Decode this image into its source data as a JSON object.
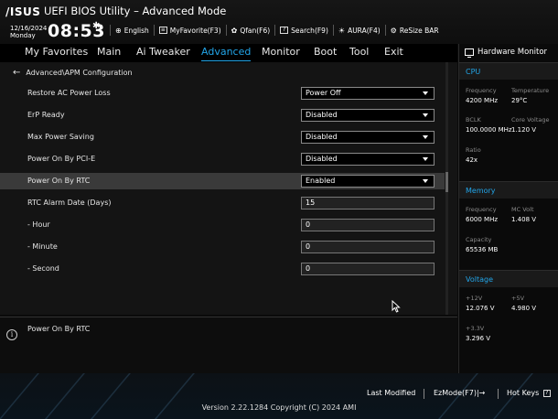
{
  "header": {
    "logo": "/ISUS",
    "title": "UEFI BIOS Utility – Advanced Mode",
    "date": "12/16/2024",
    "day": "Monday",
    "time": "08:53",
    "toolbar": [
      {
        "icon": "globe-icon",
        "label": "English"
      },
      {
        "icon": "favorite-icon",
        "label": "MyFavorite(F3)"
      },
      {
        "icon": "fan-icon",
        "label": "Qfan(F6)"
      },
      {
        "icon": "search-icon",
        "label": "Search(F9)"
      },
      {
        "icon": "aura-icon",
        "label": "AURA(F4)"
      },
      {
        "icon": "resize-bar-icon",
        "label": "ReSize BAR"
      }
    ]
  },
  "menu": [
    {
      "label": "My Favorites"
    },
    {
      "label": "Main"
    },
    {
      "label": "Ai Tweaker"
    },
    {
      "label": "Advanced",
      "active": true
    },
    {
      "label": "Monitor"
    },
    {
      "label": "Boot"
    },
    {
      "label": "Tool"
    },
    {
      "label": "Exit"
    }
  ],
  "breadcrumb": "Advanced\\APM Configuration",
  "settings": [
    {
      "label": "Restore AC Power Loss",
      "type": "select",
      "value": "Power Off"
    },
    {
      "label": "ErP Ready",
      "type": "select",
      "value": "Disabled"
    },
    {
      "label": "Max Power Saving",
      "type": "select",
      "value": "Disabled"
    },
    {
      "label": "Power On By PCI-E",
      "type": "select",
      "value": "Disabled"
    },
    {
      "label": "Power On By RTC",
      "type": "select",
      "value": "Enabled",
      "selected": true
    },
    {
      "label": "RTC Alarm Date (Days)",
      "type": "input",
      "value": "15"
    },
    {
      "label": " - Hour",
      "type": "input",
      "value": "0"
    },
    {
      "label": " - Minute",
      "type": "input",
      "value": "0"
    },
    {
      "label": " - Second",
      "type": "input",
      "value": "0"
    }
  ],
  "help": {
    "text": "Power On By RTC"
  },
  "hardware_monitor": {
    "title": "Hardware Monitor",
    "cpu": {
      "heading": "CPU",
      "frequency_label": "Frequency",
      "frequency": "4200 MHz",
      "temperature_label": "Temperature",
      "temperature": "29°C",
      "bclk_label": "BCLK",
      "bclk": "100.0000 MHz",
      "core_voltage_label": "Core Voltage",
      "core_voltage": "1.120 V",
      "ratio_label": "Ratio",
      "ratio": "42x"
    },
    "memory": {
      "heading": "Memory",
      "frequency_label": "Frequency",
      "frequency": "6000 MHz",
      "mc_volt_label": "MC Volt",
      "mc_volt": "1.408 V",
      "capacity_label": "Capacity",
      "capacity": "65536 MB"
    },
    "voltage": {
      "heading": "Voltage",
      "v12_label": "+12V",
      "v12": "12.076 V",
      "v5_label": "+5V",
      "v5": "4.980 V",
      "v33_label": "+3.3V",
      "v33": "3.296 V"
    }
  },
  "footer": {
    "last_modified": "Last Modified",
    "ezmode": "EzMode(F7)|→",
    "hotkeys": "Hot Keys",
    "hotkeys_key": "?",
    "version": "Version 2.22.1284 Copyright (C) 2024 AMI"
  },
  "colors": {
    "accent": "#22a5e8",
    "background": "#141414",
    "selected_row": "#3a3a3a"
  }
}
